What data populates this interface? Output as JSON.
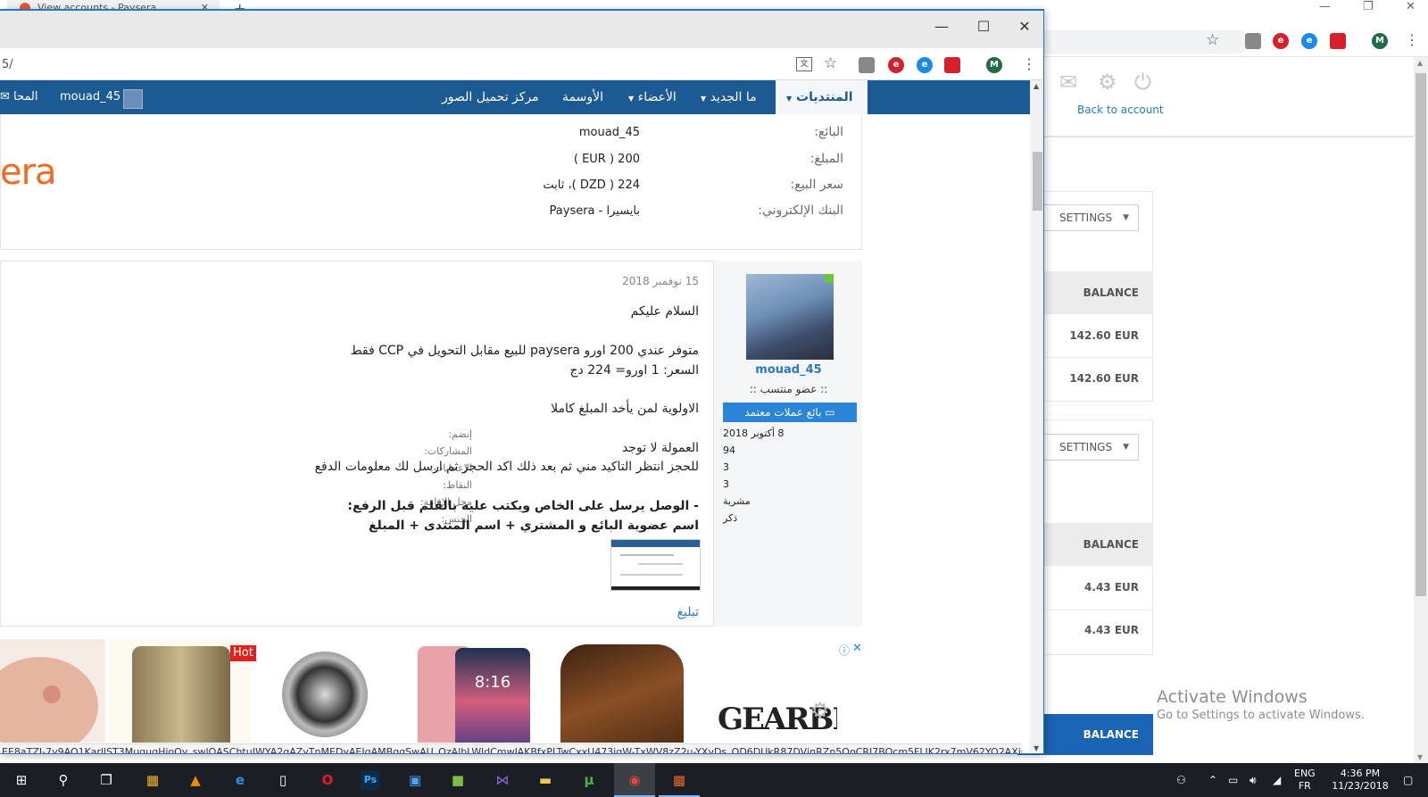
{
  "background_window": {
    "tab_title": "View accounts - Paysera",
    "new_tab": "+",
    "window_controls": {
      "minimize": "—",
      "restore": "❐",
      "close": "✕"
    },
    "toolbar_avatar": "M",
    "back_to_account": "Back to account",
    "accounts": [
      {
        "settings_label": "SETTINGS",
        "balance_label": "BALANCE",
        "amounts": [
          "142.60 EUR",
          "142.60 EUR"
        ]
      },
      {
        "settings_label": "SETTINGS",
        "balance_label": "BALANCE",
        "amounts": [
          "4.43 EUR",
          "4.43 EUR"
        ]
      }
    ],
    "last_balance_label": "BALANCE",
    "watermark": {
      "line1": "Activate Windows",
      "line2": "Go to Settings to activate Windows."
    }
  },
  "foreground_window": {
    "window_controls": {
      "minimize": "—",
      "maximize": "☐",
      "close": "✕"
    },
    "url_fragment": "5/",
    "toolbar_avatar": "M",
    "translate_icon": "文",
    "forum_nav": {
      "forums": "المنتديات",
      "whats_new": "ما الجديد",
      "members": "الأعضاء",
      "medals": "الأوسمة",
      "upload_center": "مركز تحميل الصور",
      "username": "mouad_45",
      "inbox": "المحا"
    },
    "listing": {
      "seller_label": "البائع:",
      "seller_value": "mouad_45",
      "amount_label": "المبلغ:",
      "amount_value": "200 ( EUR )",
      "price_label": "سعر البيع:",
      "price_value": "224 ( DZD )، ثابت",
      "bank_label": "البنك الإلكتروني:",
      "bank_value": "بايسيرا - Paysera",
      "logo_fragment": "era"
    },
    "post": {
      "date": "15 نوفمبر 2018",
      "lines": [
        "السلام عليكم",
        "متوفر عندي 200 اورو paysera للبيع مقابل التحويل في CCP فقط",
        "السعر: 1 اورو= 224 دج",
        "الاولوية لمن يأخد المبلغ كاملا",
        "العمولة لا توجد",
        "للحجز انتظر التاكيد مني ثم بعد ذلك اكد الحجز ثم ارسل لك معلومات الدفع",
        "- الوصل يرسل على الخاص ويكتب عليه بالقلم قبل الرفع:",
        "اسم عضوية البائع و المشتري + اسم المنتدى + المبلغ"
      ],
      "report": "تبليغ",
      "author": {
        "username": "mouad_45",
        "title": ":: عضو منتسب ::",
        "badge": "بائع عملات معتمد",
        "info": [
          {
            "label": "إنضم:",
            "value": "8 أكتوبر 2018"
          },
          {
            "label": "المشاركات:",
            "value": "94"
          },
          {
            "label": "الإعجابات:",
            "value": "3"
          },
          {
            "label": "النقاط:",
            "value": "3"
          },
          {
            "label": "محل الإقامة:",
            "value": "مشرية"
          },
          {
            "label": "الجنس:",
            "value": "ذكر"
          }
        ]
      }
    },
    "ads": {
      "hot": "Hot",
      "phone_time": "8:16",
      "gearbest": "GEARBEST",
      "info": "ⓘ",
      "close": "✕"
    },
    "status_url": "EE8aTZI-7v9AO1KarllST3MuqugHjoOy_swlQASChtuJWYA2gAZyTnMEDyAEJqAMBqgSwAU_QzAlbLWldCmwJAKBfxPLTwCxxU473iqW-TxWV8zZ2u-YXvDs_QD6DUkR87DVjnRZn5OoCRJ7BOcm5FLJK2rx7mV62YO2AXjuKa..."
  },
  "taskbar": {
    "lang_line1": "ENG",
    "lang_line2": "FR",
    "time": "4:36 PM",
    "date": "11/23/2018"
  }
}
